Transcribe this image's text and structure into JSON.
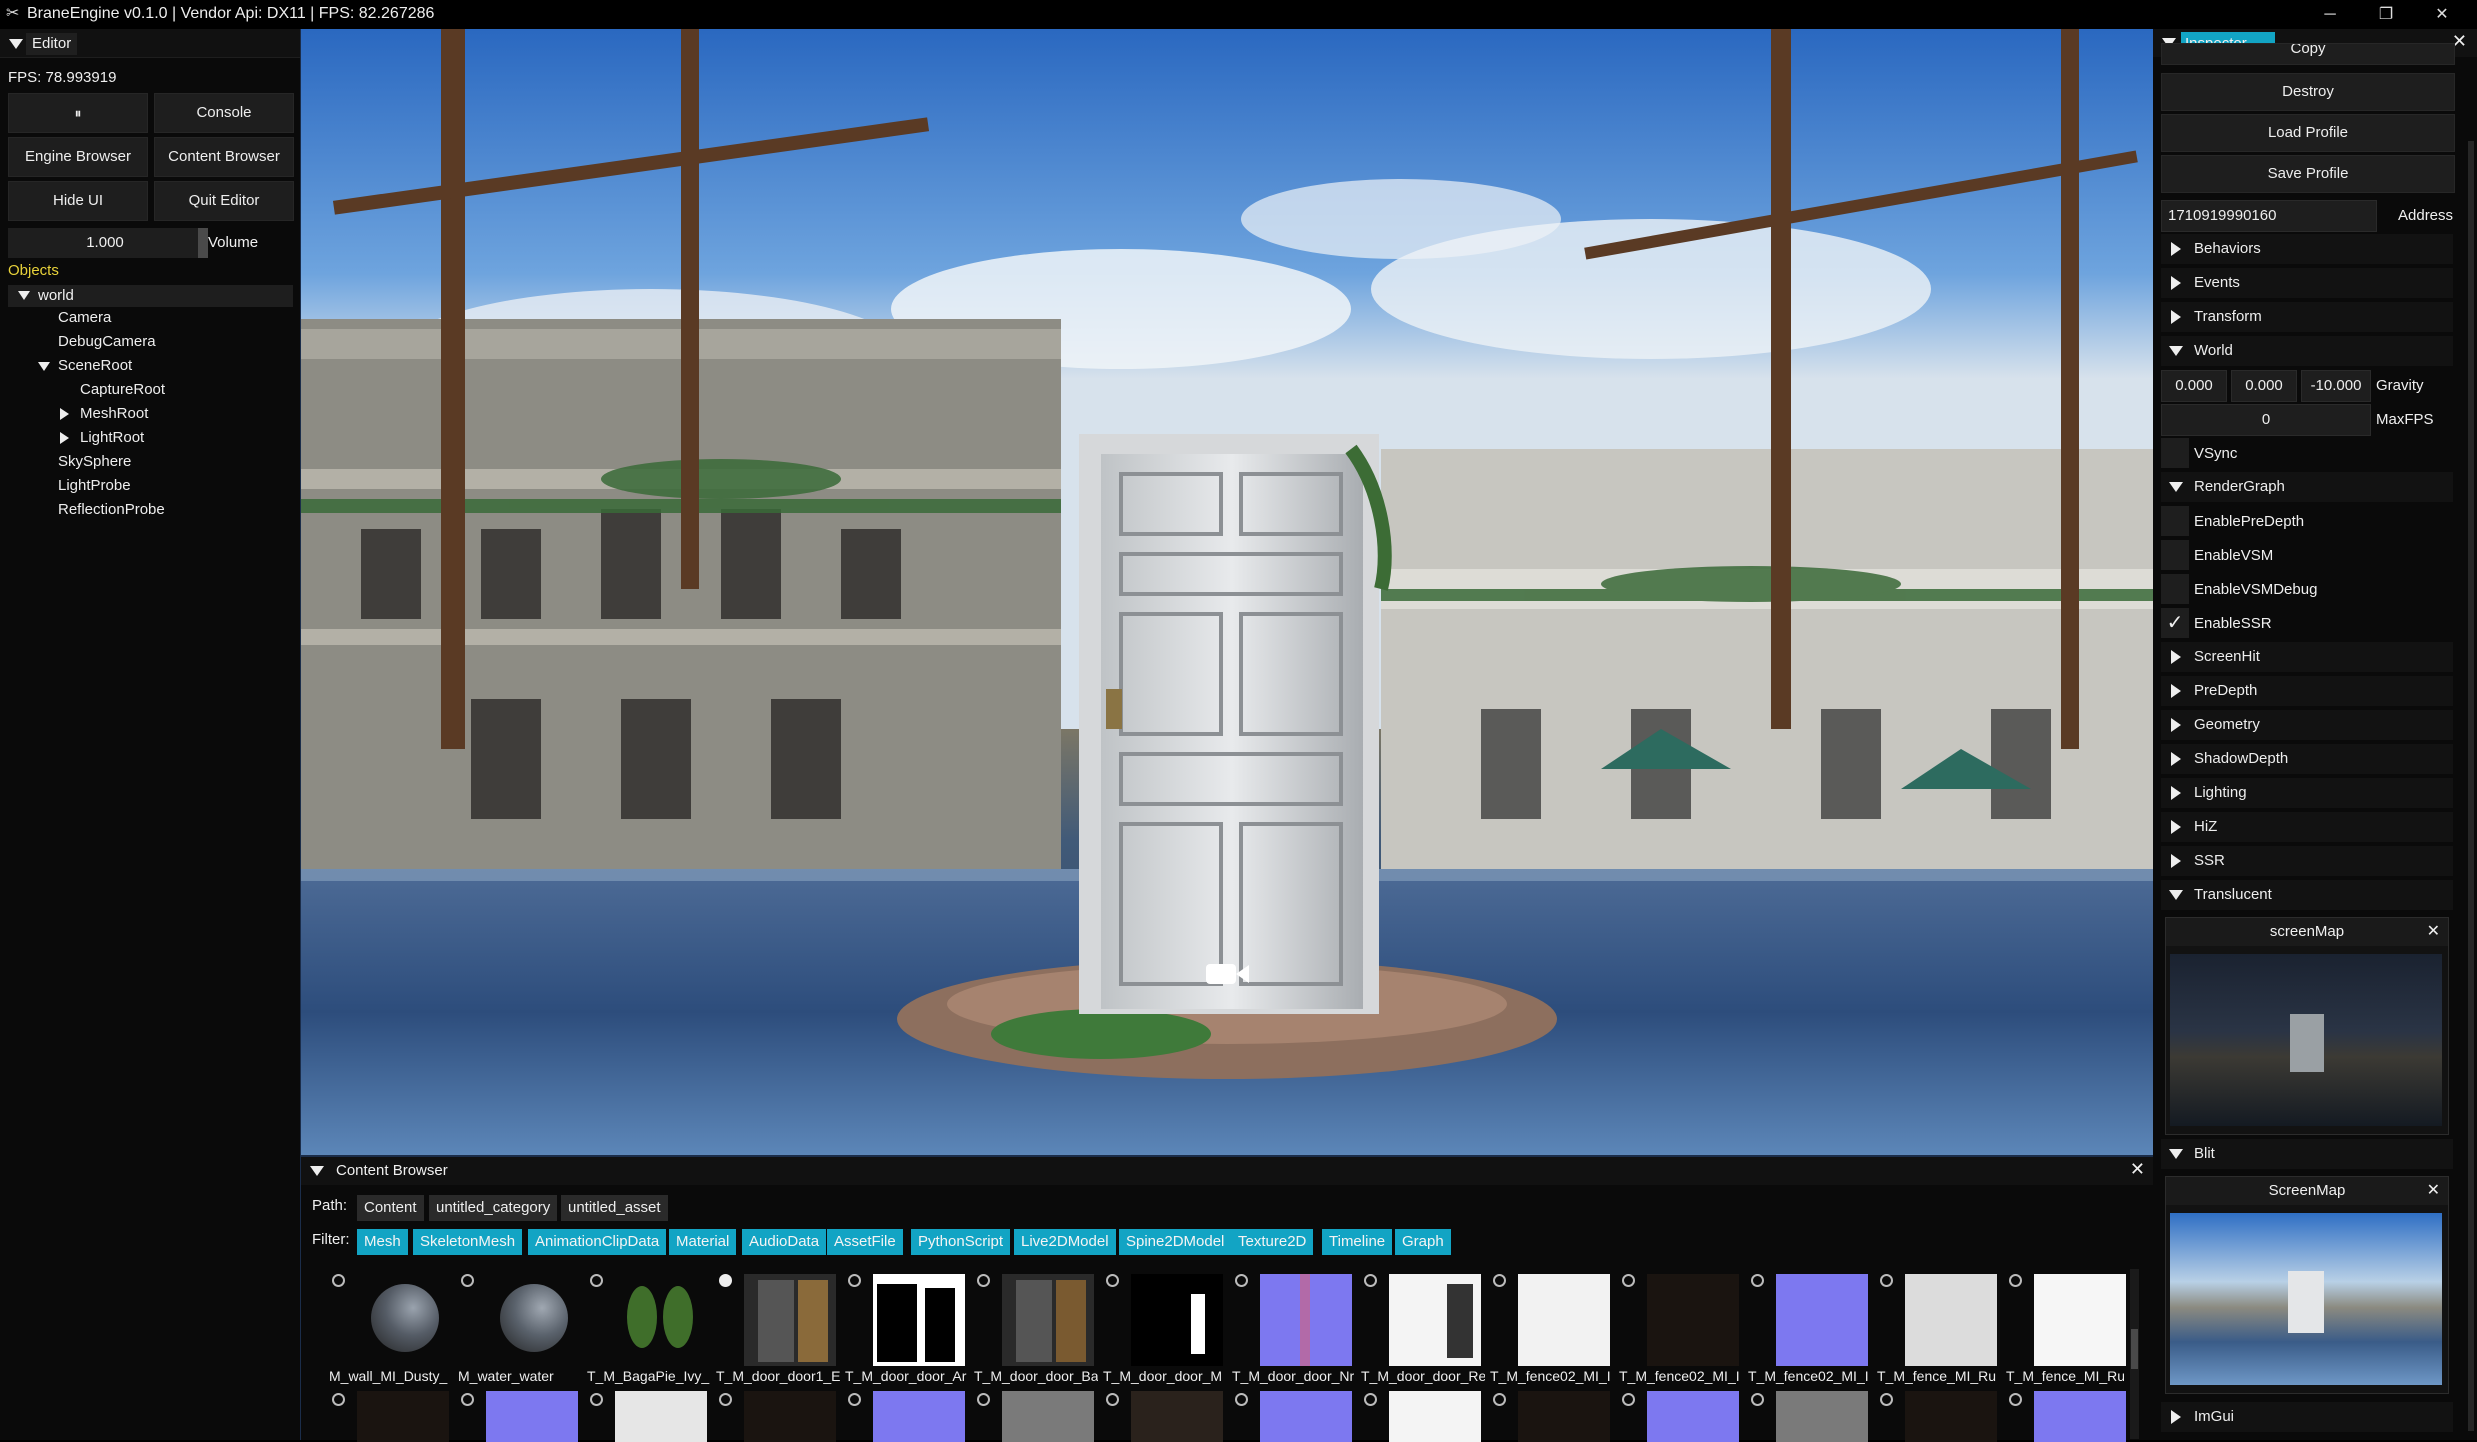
{
  "titlebar": {
    "title": "BraneEngine v0.1.0 | Vendor Api: DX11 | FPS: 82.267286",
    "minimize": "─",
    "restore": "❐",
    "close": "✕"
  },
  "editor": {
    "tab": "Editor",
    "fps": "FPS: 78.993919",
    "pause_icon": "⏸",
    "buttons": {
      "console": "Console",
      "engine_browser": "Engine Browser",
      "content_browser": "Content Browser",
      "hide_ui": "Hide UI",
      "quit_editor": "Quit Editor"
    },
    "volume_value": "1.000",
    "volume_label": "Volume",
    "objects_header": "Objects",
    "tree": {
      "world": "world",
      "camera": "Camera",
      "debug_camera": "DebugCamera",
      "scene_root": "SceneRoot",
      "capture_root": "CaptureRoot",
      "mesh_root": "MeshRoot",
      "light_root": "LightRoot",
      "sky_sphere": "SkySphere",
      "light_probe": "LightProbe",
      "reflection_probe": "ReflectionProbe"
    }
  },
  "inspector": {
    "tab": "Inspector",
    "close": "✕",
    "copy": "Copy",
    "destroy": "Destroy",
    "load_profile": "Load Profile",
    "save_profile": "Save Profile",
    "address_value": "1710919990160",
    "address_label": "Address",
    "sections": {
      "behaviors": "Behaviors",
      "events": "Events",
      "transform": "Transform",
      "world": "World",
      "render_graph": "RenderGraph",
      "screen_hit": "ScreenHit",
      "pre_depth": "PreDepth",
      "geometry": "Geometry",
      "shadow_depth": "ShadowDepth",
      "lighting": "Lighting",
      "hiz": "HiZ",
      "ssr": "SSR",
      "translucent": "Translucent",
      "blit": "Blit",
      "imgui": "ImGui"
    },
    "gravity": {
      "x": "0.000",
      "y": "0.000",
      "z": "-10.000",
      "label": "Gravity"
    },
    "maxfps": {
      "value": "0",
      "label": "MaxFPS"
    },
    "checks": {
      "vsync": "VSync",
      "enable_pre_depth": "EnablePreDepth",
      "enable_vsm": "EnableVSM",
      "enable_vsm_debug": "EnableVSMDebug",
      "enable_ssr": "EnableSSR",
      "checkmark": "✓"
    },
    "translucent_map": "screenMap",
    "blit_map": "ScreenMap"
  },
  "content_browser": {
    "tab": "Content Browser",
    "close": "✕",
    "path_label": "Path:",
    "path": [
      "Content",
      "untitled_category",
      "untitled_asset"
    ],
    "filter_label": "Filter:",
    "filters": [
      "Mesh",
      "SkeletonMesh",
      "AnimationClipData",
      "Material",
      "AudioData",
      "AssetFile",
      "PythonScript",
      "Live2DModel",
      "Spine2DModel",
      "Texture2D",
      "Timeline",
      "Graph"
    ],
    "assets": [
      "M_wall_MI_Dusty_",
      "M_water_water",
      "T_M_BagaPie_Ivy_",
      "T_M_door_door1_E",
      "T_M_door_door_Ar",
      "T_M_door_door_Ba",
      "T_M_door_door_M",
      "T_M_door_door_Nr",
      "T_M_door_door_Re",
      "T_M_fence02_MI_I",
      "T_M_fence02_MI_I",
      "T_M_fence02_MI_I",
      "T_M_fence_MI_Ru"
    ]
  }
}
